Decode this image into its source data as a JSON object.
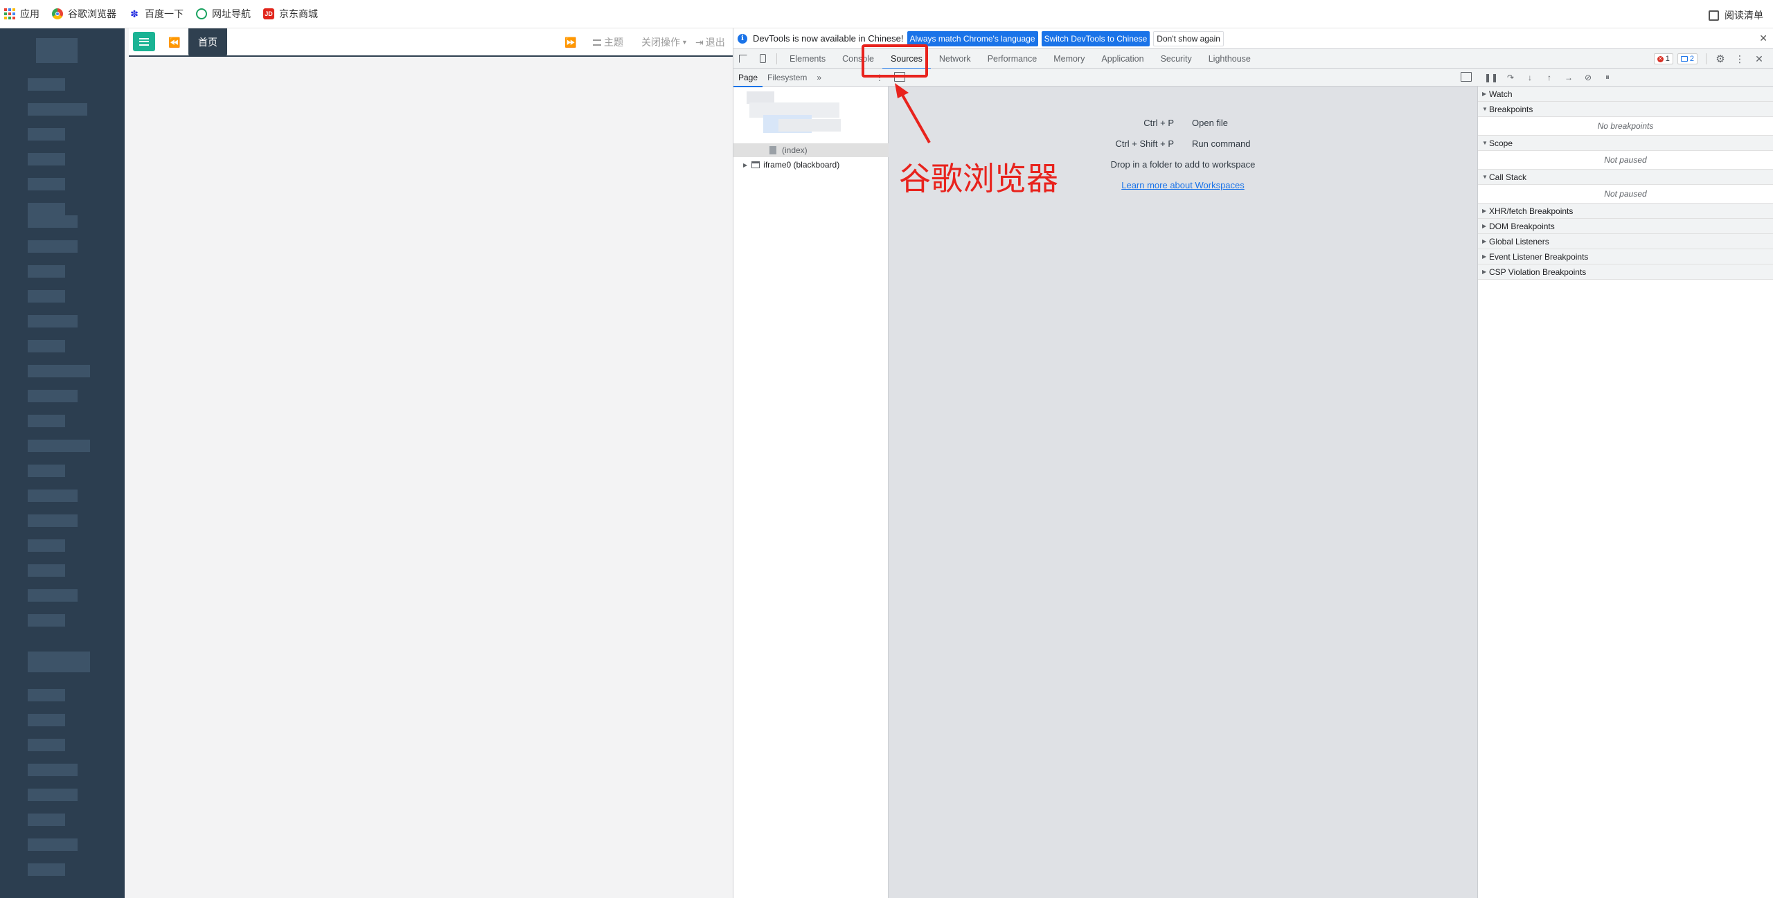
{
  "bookmarks": {
    "items": [
      {
        "label": "应用"
      },
      {
        "label": "谷歌浏览器"
      },
      {
        "label": "百度一下"
      },
      {
        "label": "网址导航"
      },
      {
        "label": "京东商城"
      }
    ],
    "reading_list": "阅读清单"
  },
  "app": {
    "home_tab": "首页",
    "theme": "主题",
    "close_ops": "关闭操作",
    "logout": "退出",
    "accent_color": "#1ab394",
    "sidebar_color": "#2c3e50"
  },
  "devtools": {
    "infobar": {
      "message": "DevTools is now available in Chinese!",
      "btn_match": "Always match Chrome's language",
      "btn_switch": "Switch DevTools to Chinese",
      "btn_dismiss": "Don't show again"
    },
    "tabs": [
      "Elements",
      "Console",
      "Sources",
      "Network",
      "Performance",
      "Memory",
      "Application",
      "Security",
      "Lighthouse"
    ],
    "active_tab": "Sources",
    "error_count": "1",
    "message_count": "2",
    "navigator": {
      "tabs": [
        "Page",
        "Filesystem"
      ],
      "index_file": "(index)",
      "iframe": "iframe0 (blackboard)"
    },
    "editor": {
      "shortcut1_key": "Ctrl + P",
      "shortcut1_label": "Open file",
      "shortcut2_key": "Ctrl + Shift + P",
      "shortcut2_label": "Run command",
      "drop_hint": "Drop in a folder to add to workspace",
      "workspace_link": "Learn more about Workspaces"
    },
    "debugger": {
      "watch": "Watch",
      "breakpoints": "Breakpoints",
      "no_breakpoints": "No breakpoints",
      "scope": "Scope",
      "scope_body": "Not paused",
      "call_stack": "Call Stack",
      "call_stack_body": "Not paused",
      "xhr": "XHR/fetch Breakpoints",
      "dom": "DOM Breakpoints",
      "global": "Global Listeners",
      "event": "Event Listener Breakpoints",
      "csp": "CSP Violation Breakpoints"
    }
  },
  "annotation": {
    "text": "谷歌浏览器",
    "color": "#e8231d"
  }
}
